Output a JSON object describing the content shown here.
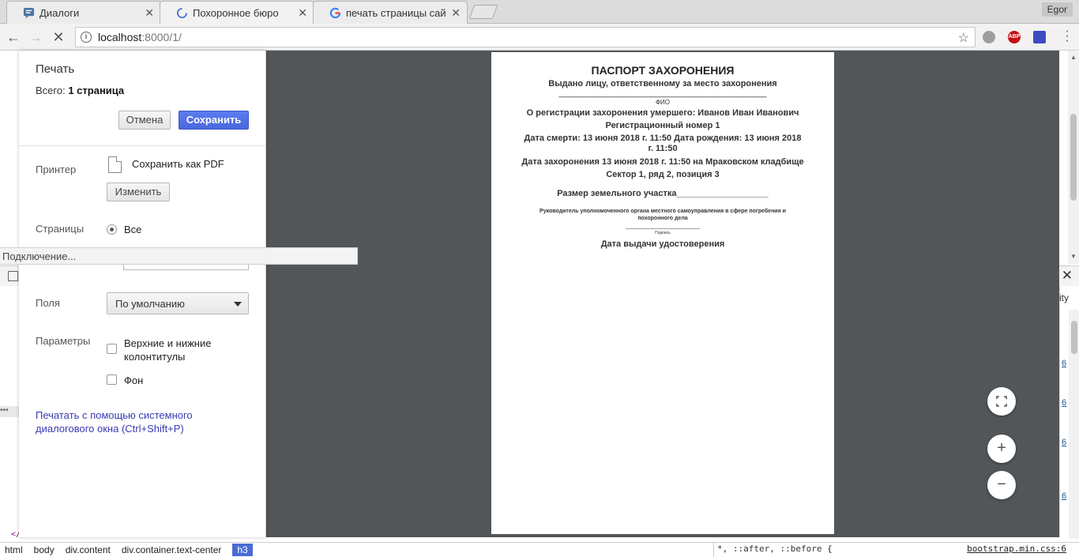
{
  "tabs": [
    {
      "title": "Диалоги",
      "icon": "chat-icon"
    },
    {
      "title": "Похоронное бюро",
      "icon": "loading-icon",
      "active": true
    },
    {
      "title": "печать страницы сайт",
      "icon": "google-icon"
    }
  ],
  "user": {
    "name": "Egor"
  },
  "toolbar": {
    "url_host": "localhost",
    "url_path": ":8000/1/"
  },
  "print": {
    "title": "Печать",
    "total_label": "Всего:",
    "total_value": "1 страница",
    "cancel_label": "Отмена",
    "save_label": "Сохранить",
    "printer_label": "Принтер",
    "printer_value": "Сохранить как PDF",
    "change_label": "Изменить",
    "pages_label": "Страницы",
    "pages_all": "Все",
    "margins_label": "Поля",
    "margins_value": "По умолчанию",
    "options_label": "Параметры",
    "headers_footers": "Верхние и нижние колонтитулы",
    "background": "Фон",
    "system_dialog_link": "Печатать с помощью системного диалогового окна (Ctrl+Shift+P)"
  },
  "status": "Подключение...",
  "document": {
    "title": "ПАСПОРТ ЗАХОРОНЕНИЯ",
    "issued_to": "Выдано лицу, ответственному за место захоронения",
    "underline": "___________________________________________",
    "fio": "ФИО",
    "registration": "О регистрации захоронения умершего: Иванов Иван Иванович",
    "reg_number": "Регистрационный номер 1",
    "dates": "Дата смерти: 13 июня 2018 г. 11:50 Дата рождения: 13 июня 2018 г. 11:50",
    "burial": "Дата захоронения 13 июня 2018 г. 11:50 на Мраковском кладбище",
    "sector": "Сектор 1, ряд 2, позиция 3",
    "land_size": "Размер земельного участка___________________",
    "head": "Руководитель уполномоченного органа местного самоуправления в сфере погребения и похоронного дела",
    "sign_line": "________________________",
    "signature": "Подпись",
    "issue_date": "Дата выдачи удостоверения"
  },
  "devtools": {
    "crumbs": [
      "html",
      "body",
      "div.content",
      "div.container.text-center",
      "h3"
    ],
    "style_rule": "*, ::after, ::before {",
    "style_source": "bootstrap.min.css:6",
    "right_snippets": [
      "ity",
      "6",
      "6",
      "6",
      "6"
    ],
    "bg_tag": "</"
  }
}
